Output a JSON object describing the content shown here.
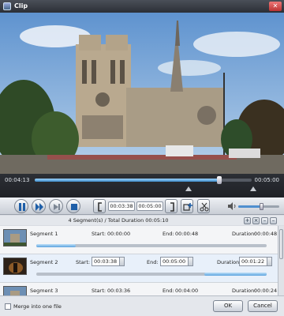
{
  "window": {
    "title": "Clip"
  },
  "timeline": {
    "current": "00:04:13",
    "end": "00:05:00",
    "progress_fraction": 0.85
  },
  "controls": {
    "start_time": "00:03:38",
    "end_time": "00:05:00",
    "volume_fraction": 0.55
  },
  "segments_header": {
    "summary": "4 Segment(s) / Total Duration 00:05:10"
  },
  "segments": [
    {
      "name": "Segment 1",
      "start_label": "Start:",
      "start": "00:00:00",
      "end_label": "End:",
      "end": "00:00:48",
      "duration_label": "Duration:",
      "duration": "00:00:48"
    },
    {
      "name": "Segment 2",
      "start_label": "Start:",
      "start": "00:03:38",
      "end_label": "End:",
      "end": "00:05:00",
      "duration_label": "Duration:",
      "duration": "00:01:22"
    },
    {
      "name": "Segment 3",
      "start_label": "Start:",
      "start": "00:03:36",
      "end_label": "End:",
      "end": "00:04:00",
      "duration_label": "Duration:",
      "duration": "00:00:24"
    }
  ],
  "footer": {
    "merge_label": "Merge into one file",
    "ok_label": "OK",
    "cancel_label": "Cancel"
  },
  "colors": {
    "accent": "#4f8fcf",
    "title_bar": "#2b2f36"
  }
}
